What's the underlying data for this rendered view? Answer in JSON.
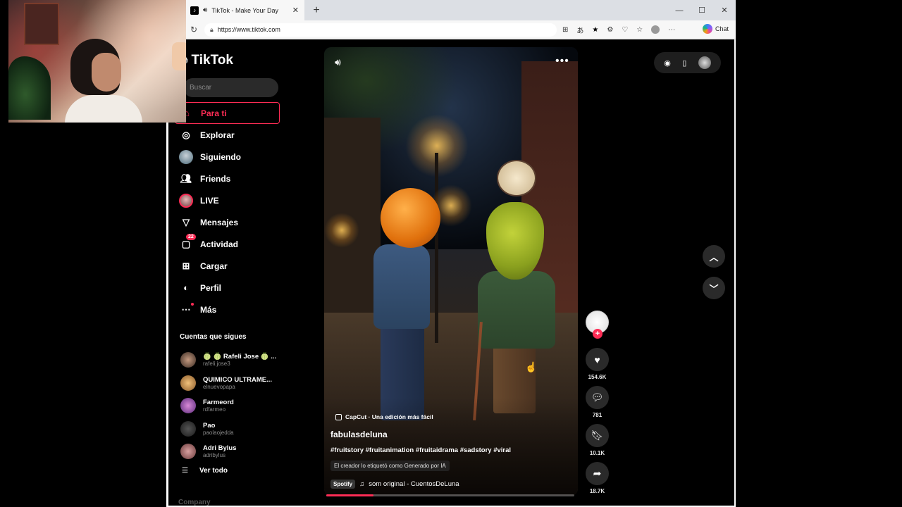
{
  "browser": {
    "tab_title": "TikTok - Make Your Day",
    "url": "https://www.tiktok.com",
    "chat_label": "Chat"
  },
  "sidebar": {
    "logo": "TikTok",
    "search_placeholder": "Buscar",
    "nav": [
      {
        "label": "Para ti",
        "icon": "home-icon",
        "active": true
      },
      {
        "label": "Explorar",
        "icon": "compass-icon"
      },
      {
        "label": "Siguiendo",
        "icon": "following-avatar-icon"
      },
      {
        "label": "Friends",
        "icon": "friends-icon"
      },
      {
        "label": "LIVE",
        "icon": "live-icon"
      },
      {
        "label": "Mensajes",
        "icon": "messages-icon"
      },
      {
        "label": "Actividad",
        "icon": "activity-icon",
        "badge": "22"
      },
      {
        "label": "Cargar",
        "icon": "upload-icon"
      },
      {
        "label": "Perfil",
        "icon": "profile-icon"
      },
      {
        "label": "Más",
        "icon": "more-icon"
      }
    ],
    "following_title": "Cuentas que sigues",
    "accounts": [
      {
        "name": "🍈 🍈 Rafeli Jose 🍈 ...",
        "handle": "rafeli.jose3"
      },
      {
        "name": "QUIMICO ULTRAME...",
        "handle": "elnuevopapa"
      },
      {
        "name": "Farmeord",
        "handle": "rdfarmeo"
      },
      {
        "name": "Pao",
        "handle": "paolaojedda"
      },
      {
        "name": "Adri Bylus",
        "handle": "adribylus"
      }
    ],
    "see_all": "Ver todo",
    "company": "Company"
  },
  "video": {
    "capcut_label": "CapCut · Una edición más fácil",
    "author": "fabulasdeluna",
    "tags": "#fruitstory #fruitanimation #fruitaidrama #sadstory #viral",
    "ai_label": "El creador lo etiquetó como Generado por IA",
    "spotify": "Spotify",
    "music": "som original - CuentosDeLuna",
    "progress_pct": 19
  },
  "actions": {
    "likes": "154.6K",
    "comments": "781",
    "saves": "10.1K",
    "shares": "18.7K"
  },
  "colors": {
    "accent": "#fe2c55",
    "background": "#000000"
  }
}
